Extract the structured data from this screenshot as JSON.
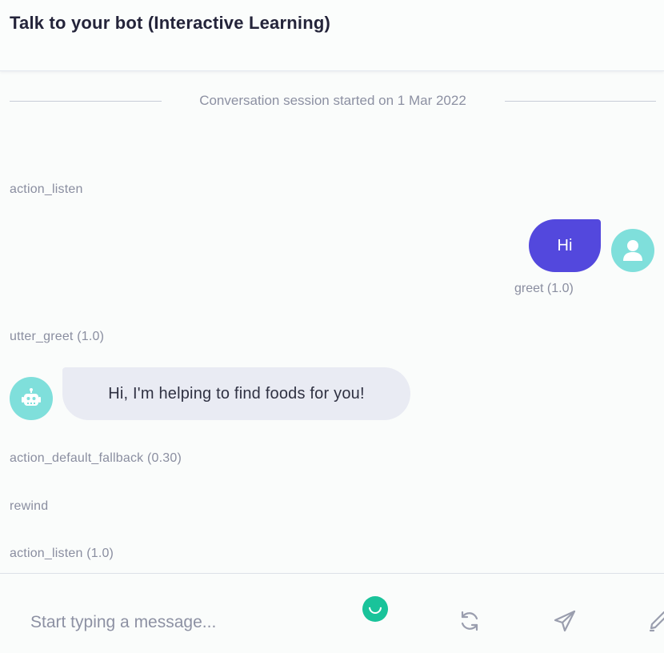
{
  "header": {
    "title": "Talk to your bot (Interactive Learning)"
  },
  "session": {
    "label": "Conversation session started on 1 Mar 2022"
  },
  "events": {
    "action_listen_1": "action_listen",
    "utter_greet": "utter_greet  (1.0)",
    "fallback": "action_default_fallback  (0.30)",
    "rewind": "rewind",
    "action_listen_2": "action_listen  (1.0)"
  },
  "user_message": {
    "text": "Hi",
    "intent": "greet  (1.0)"
  },
  "bot_message": {
    "text": "Hi, I'm helping to find foods for you!"
  },
  "composer": {
    "placeholder": "Start typing a message..."
  },
  "icons": {
    "user_avatar": "user-icon",
    "bot_avatar": "robot-icon",
    "loading": "spinner-icon",
    "restart": "refresh-icon",
    "send": "send-icon",
    "edit": "pen-icon"
  },
  "colors": {
    "user_bubble": "#5348dd",
    "bot_bubble": "#e9ebf3",
    "avatar": "#7fdfdb",
    "spinner": "#19c39a"
  }
}
